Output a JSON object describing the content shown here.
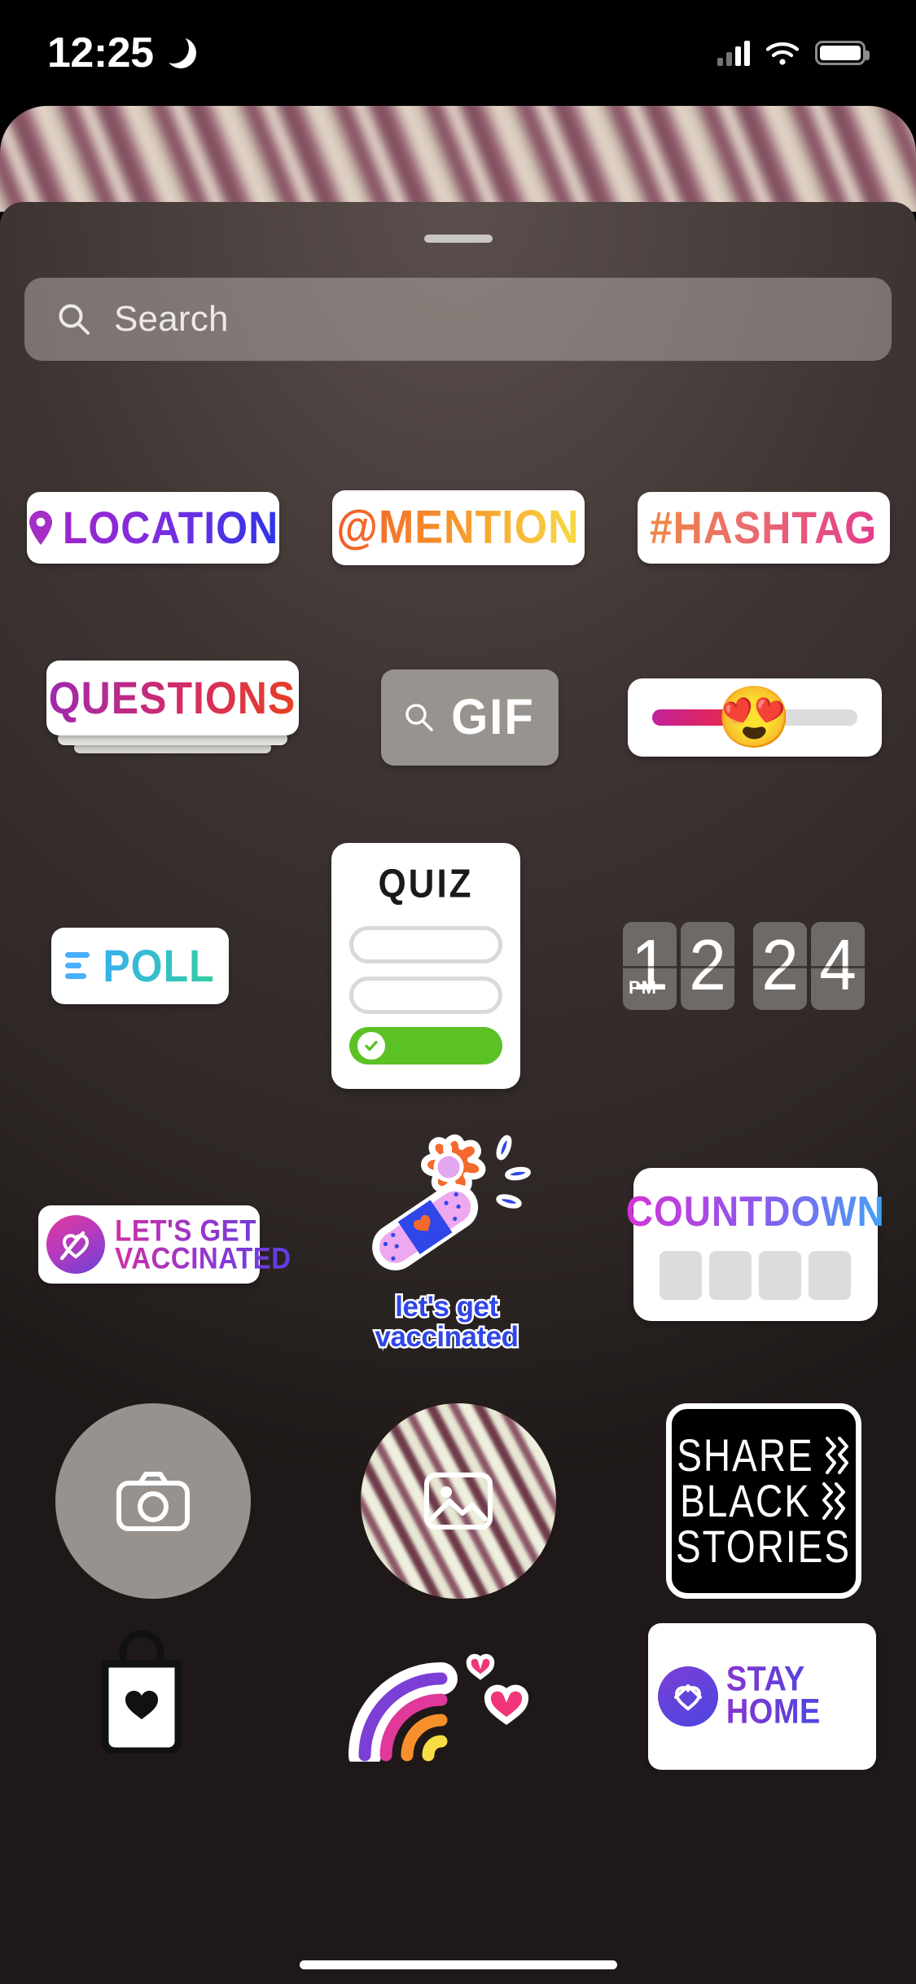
{
  "status_bar": {
    "time": "12:25",
    "dnd_icon": "moon-icon",
    "signal_icon": "cellular-signal-icon",
    "wifi_icon": "wifi-icon",
    "battery_icon": "battery-icon"
  },
  "sheet": {
    "grabber": "drag-handle"
  },
  "search": {
    "placeholder": "Search",
    "value": "",
    "icon": "search-icon"
  },
  "stickers": {
    "location": {
      "label": "LOCATION",
      "icon": "location-pin-icon",
      "gradient": "#a223c8 → #2b34e8"
    },
    "mention": {
      "label": "@MENTION",
      "gradient": "#f05a28 → #f8dd44"
    },
    "hashtag": {
      "label": "#HASHTAG",
      "gradient": "#f08a43 → #e23b8f"
    },
    "questions": {
      "label": "QUESTIONS",
      "gradient": "#9c29b0 → #e8401f"
    },
    "gif": {
      "label": "GIF",
      "icon": "search-icon"
    },
    "slider": {
      "emoji": "😍",
      "fill_percent": "50",
      "fill_gradient": "#c2219b → #ee3b2e"
    },
    "poll": {
      "label": "POLL",
      "icon": "poll-bars-icon",
      "gradient": "#36b0ef → #33cfa0"
    },
    "quiz": {
      "title": "QUIZ",
      "options": [
        "",
        "",
        ""
      ],
      "correct_index": "2",
      "correct_color": "#5cc125"
    },
    "clock": {
      "digits": [
        "1",
        "2",
        "2",
        "4"
      ],
      "meridiem": "PM"
    },
    "lets_get_vaccinated": {
      "line1": "LET'S GET",
      "line2": "VACCINATED",
      "icon": "heart-ribbon-icon"
    },
    "flower_vaccinated": {
      "line1": "let's get",
      "line2": "vaccinated",
      "icon": "flower-bandage-icon"
    },
    "countdown": {
      "label": "COUNTDOWN",
      "gradient": "#d633d6 → #3fa4f5",
      "tiles": [
        "",
        "",
        "",
        ""
      ]
    },
    "camera": {
      "icon": "camera-icon"
    },
    "photo": {
      "icon": "photo-icon"
    },
    "share_black_stories": {
      "line1": "SHARE",
      "line2": "BLACK",
      "line3": "STORIES"
    },
    "shop": {
      "icon": "shopping-bag-heart-icon"
    },
    "rainbow": {
      "icon": "rainbow-heart-icon"
    },
    "stay_home": {
      "line1": "STAY",
      "line2": "HOME",
      "icon": "heart-house-icon"
    }
  }
}
